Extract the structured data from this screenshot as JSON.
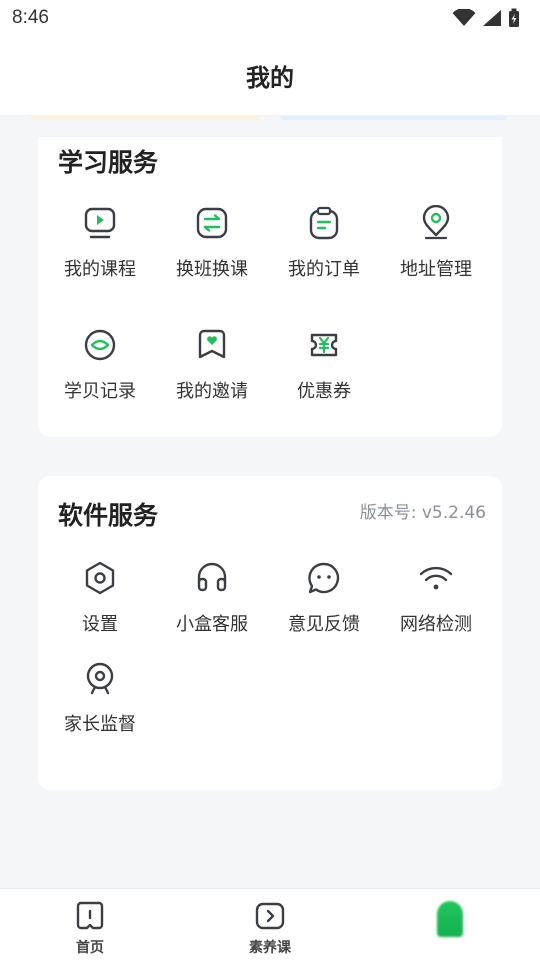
{
  "status_bar": {
    "time": "8:46"
  },
  "header": {
    "title": "我的"
  },
  "study_services": {
    "title": "学习服务",
    "items": [
      {
        "label": "我的课程",
        "icon": "course-play-icon"
      },
      {
        "label": "换班换课",
        "icon": "swap-class-icon"
      },
      {
        "label": "我的订单",
        "icon": "order-clipboard-icon"
      },
      {
        "label": "地址管理",
        "icon": "location-pin-icon"
      },
      {
        "label": "学贝记录",
        "icon": "coin-record-icon"
      },
      {
        "label": "我的邀请",
        "icon": "invite-heart-icon"
      },
      {
        "label": "优惠券",
        "icon": "coupon-yen-icon"
      }
    ]
  },
  "software_services": {
    "title": "软件服务",
    "version": "版本号: v5.2.46",
    "items": [
      {
        "label": "设置",
        "icon": "settings-hex-icon"
      },
      {
        "label": "小盒客服",
        "icon": "headset-icon"
      },
      {
        "label": "意见反馈",
        "icon": "feedback-chat-icon"
      },
      {
        "label": "网络检测",
        "icon": "wifi-icon"
      },
      {
        "label": "家长监督",
        "icon": "webcam-icon"
      }
    ]
  },
  "tab_bar": {
    "tabs": [
      {
        "label": "首页",
        "icon": "home-book-icon"
      },
      {
        "label": "素养课",
        "icon": "play-box-icon"
      },
      {
        "label": "",
        "icon": "profile-active-icon"
      }
    ]
  },
  "colors": {
    "accent": "#1fc15a",
    "icon_stroke": "#3b3f45"
  }
}
